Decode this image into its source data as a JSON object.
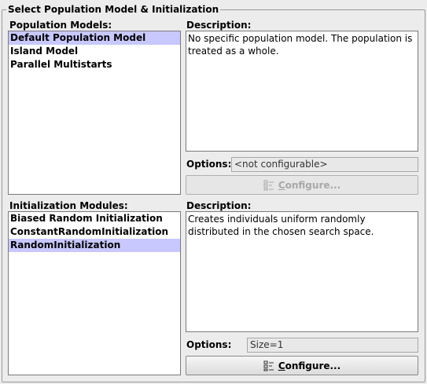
{
  "panel": {
    "title": "Select Population Model & Initialization"
  },
  "population": {
    "list_label": "Population Models:",
    "items": [
      {
        "label": "Default Population Model",
        "selected": true
      },
      {
        "label": "Island Model",
        "selected": false
      },
      {
        "label": "Parallel Multistarts",
        "selected": false
      }
    ],
    "description_label": "Description:",
    "description": "No specific population model. The population is treated as a whole.",
    "options_label": "Options:",
    "options_value": "<not configurable>",
    "configure_mnemonic": "C",
    "configure_rest": "onfigure...",
    "configure_enabled": false,
    "configure_icon": "configure-icon"
  },
  "initialization": {
    "list_label": "Initialization Modules:",
    "items": [
      {
        "label": "Biased Random Initialization",
        "selected": false
      },
      {
        "label": "ConstantRandomInitialization",
        "selected": false
      },
      {
        "label": "RandomInitialization",
        "selected": true
      }
    ],
    "description_label": "Description:",
    "description": "Creates individuals uniform randomly distributed in the chosen search space.",
    "options_label": "Options:",
    "options_value": "Size=1",
    "configure_mnemonic": "C",
    "configure_rest": "onfigure...",
    "configure_enabled": true,
    "configure_icon": "configure-icon"
  }
}
